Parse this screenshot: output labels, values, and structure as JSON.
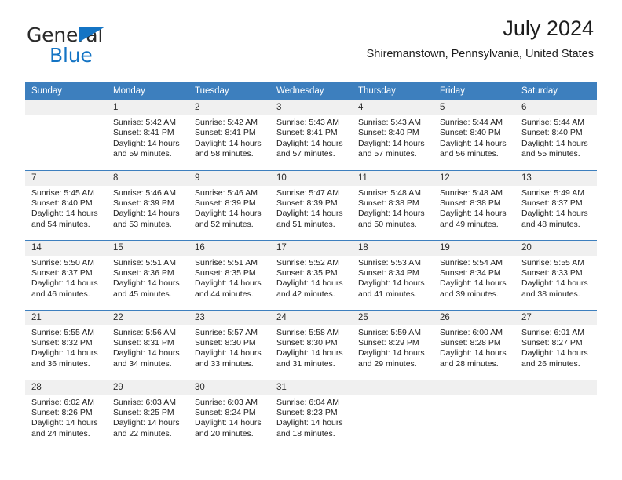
{
  "brand": {
    "line1": "General",
    "line2": "Blue",
    "triangle_color": "#1474c4",
    "text_color": "#2b2b2b"
  },
  "header": {
    "title": "July 2024",
    "subtitle": "Shiremanstown, Pennsylvania, United States"
  },
  "theme": {
    "header_blue": "#3d7fbe",
    "daynum_band": "#f0f0f0",
    "text": "#1f1f1f"
  },
  "calendar": {
    "weekday_headers": [
      "Sunday",
      "Monday",
      "Tuesday",
      "Wednesday",
      "Thursday",
      "Friday",
      "Saturday"
    ],
    "weeks": [
      [
        {
          "day": "",
          "sunrise": "",
          "sunset": "",
          "daylight_line1": "",
          "daylight_line2": "",
          "empty": true
        },
        {
          "day": "1",
          "sunrise": "Sunrise: 5:42 AM",
          "sunset": "Sunset: 8:41 PM",
          "daylight_line1": "Daylight: 14 hours",
          "daylight_line2": "and 59 minutes.",
          "empty": false
        },
        {
          "day": "2",
          "sunrise": "Sunrise: 5:42 AM",
          "sunset": "Sunset: 8:41 PM",
          "daylight_line1": "Daylight: 14 hours",
          "daylight_line2": "and 58 minutes.",
          "empty": false
        },
        {
          "day": "3",
          "sunrise": "Sunrise: 5:43 AM",
          "sunset": "Sunset: 8:41 PM",
          "daylight_line1": "Daylight: 14 hours",
          "daylight_line2": "and 57 minutes.",
          "empty": false
        },
        {
          "day": "4",
          "sunrise": "Sunrise: 5:43 AM",
          "sunset": "Sunset: 8:40 PM",
          "daylight_line1": "Daylight: 14 hours",
          "daylight_line2": "and 57 minutes.",
          "empty": false
        },
        {
          "day": "5",
          "sunrise": "Sunrise: 5:44 AM",
          "sunset": "Sunset: 8:40 PM",
          "daylight_line1": "Daylight: 14 hours",
          "daylight_line2": "and 56 minutes.",
          "empty": false
        },
        {
          "day": "6",
          "sunrise": "Sunrise: 5:44 AM",
          "sunset": "Sunset: 8:40 PM",
          "daylight_line1": "Daylight: 14 hours",
          "daylight_line2": "and 55 minutes.",
          "empty": false
        }
      ],
      [
        {
          "day": "7",
          "sunrise": "Sunrise: 5:45 AM",
          "sunset": "Sunset: 8:40 PM",
          "daylight_line1": "Daylight: 14 hours",
          "daylight_line2": "and 54 minutes.",
          "empty": false
        },
        {
          "day": "8",
          "sunrise": "Sunrise: 5:46 AM",
          "sunset": "Sunset: 8:39 PM",
          "daylight_line1": "Daylight: 14 hours",
          "daylight_line2": "and 53 minutes.",
          "empty": false
        },
        {
          "day": "9",
          "sunrise": "Sunrise: 5:46 AM",
          "sunset": "Sunset: 8:39 PM",
          "daylight_line1": "Daylight: 14 hours",
          "daylight_line2": "and 52 minutes.",
          "empty": false
        },
        {
          "day": "10",
          "sunrise": "Sunrise: 5:47 AM",
          "sunset": "Sunset: 8:39 PM",
          "daylight_line1": "Daylight: 14 hours",
          "daylight_line2": "and 51 minutes.",
          "empty": false
        },
        {
          "day": "11",
          "sunrise": "Sunrise: 5:48 AM",
          "sunset": "Sunset: 8:38 PM",
          "daylight_line1": "Daylight: 14 hours",
          "daylight_line2": "and 50 minutes.",
          "empty": false
        },
        {
          "day": "12",
          "sunrise": "Sunrise: 5:48 AM",
          "sunset": "Sunset: 8:38 PM",
          "daylight_line1": "Daylight: 14 hours",
          "daylight_line2": "and 49 minutes.",
          "empty": false
        },
        {
          "day": "13",
          "sunrise": "Sunrise: 5:49 AM",
          "sunset": "Sunset: 8:37 PM",
          "daylight_line1": "Daylight: 14 hours",
          "daylight_line2": "and 48 minutes.",
          "empty": false
        }
      ],
      [
        {
          "day": "14",
          "sunrise": "Sunrise: 5:50 AM",
          "sunset": "Sunset: 8:37 PM",
          "daylight_line1": "Daylight: 14 hours",
          "daylight_line2": "and 46 minutes.",
          "empty": false
        },
        {
          "day": "15",
          "sunrise": "Sunrise: 5:51 AM",
          "sunset": "Sunset: 8:36 PM",
          "daylight_line1": "Daylight: 14 hours",
          "daylight_line2": "and 45 minutes.",
          "empty": false
        },
        {
          "day": "16",
          "sunrise": "Sunrise: 5:51 AM",
          "sunset": "Sunset: 8:35 PM",
          "daylight_line1": "Daylight: 14 hours",
          "daylight_line2": "and 44 minutes.",
          "empty": false
        },
        {
          "day": "17",
          "sunrise": "Sunrise: 5:52 AM",
          "sunset": "Sunset: 8:35 PM",
          "daylight_line1": "Daylight: 14 hours",
          "daylight_line2": "and 42 minutes.",
          "empty": false
        },
        {
          "day": "18",
          "sunrise": "Sunrise: 5:53 AM",
          "sunset": "Sunset: 8:34 PM",
          "daylight_line1": "Daylight: 14 hours",
          "daylight_line2": "and 41 minutes.",
          "empty": false
        },
        {
          "day": "19",
          "sunrise": "Sunrise: 5:54 AM",
          "sunset": "Sunset: 8:34 PM",
          "daylight_line1": "Daylight: 14 hours",
          "daylight_line2": "and 39 minutes.",
          "empty": false
        },
        {
          "day": "20",
          "sunrise": "Sunrise: 5:55 AM",
          "sunset": "Sunset: 8:33 PM",
          "daylight_line1": "Daylight: 14 hours",
          "daylight_line2": "and 38 minutes.",
          "empty": false
        }
      ],
      [
        {
          "day": "21",
          "sunrise": "Sunrise: 5:55 AM",
          "sunset": "Sunset: 8:32 PM",
          "daylight_line1": "Daylight: 14 hours",
          "daylight_line2": "and 36 minutes.",
          "empty": false
        },
        {
          "day": "22",
          "sunrise": "Sunrise: 5:56 AM",
          "sunset": "Sunset: 8:31 PM",
          "daylight_line1": "Daylight: 14 hours",
          "daylight_line2": "and 34 minutes.",
          "empty": false
        },
        {
          "day": "23",
          "sunrise": "Sunrise: 5:57 AM",
          "sunset": "Sunset: 8:30 PM",
          "daylight_line1": "Daylight: 14 hours",
          "daylight_line2": "and 33 minutes.",
          "empty": false
        },
        {
          "day": "24",
          "sunrise": "Sunrise: 5:58 AM",
          "sunset": "Sunset: 8:30 PM",
          "daylight_line1": "Daylight: 14 hours",
          "daylight_line2": "and 31 minutes.",
          "empty": false
        },
        {
          "day": "25",
          "sunrise": "Sunrise: 5:59 AM",
          "sunset": "Sunset: 8:29 PM",
          "daylight_line1": "Daylight: 14 hours",
          "daylight_line2": "and 29 minutes.",
          "empty": false
        },
        {
          "day": "26",
          "sunrise": "Sunrise: 6:00 AM",
          "sunset": "Sunset: 8:28 PM",
          "daylight_line1": "Daylight: 14 hours",
          "daylight_line2": "and 28 minutes.",
          "empty": false
        },
        {
          "day": "27",
          "sunrise": "Sunrise: 6:01 AM",
          "sunset": "Sunset: 8:27 PM",
          "daylight_line1": "Daylight: 14 hours",
          "daylight_line2": "and 26 minutes.",
          "empty": false
        }
      ],
      [
        {
          "day": "28",
          "sunrise": "Sunrise: 6:02 AM",
          "sunset": "Sunset: 8:26 PM",
          "daylight_line1": "Daylight: 14 hours",
          "daylight_line2": "and 24 minutes.",
          "empty": false
        },
        {
          "day": "29",
          "sunrise": "Sunrise: 6:03 AM",
          "sunset": "Sunset: 8:25 PM",
          "daylight_line1": "Daylight: 14 hours",
          "daylight_line2": "and 22 minutes.",
          "empty": false
        },
        {
          "day": "30",
          "sunrise": "Sunrise: 6:03 AM",
          "sunset": "Sunset: 8:24 PM",
          "daylight_line1": "Daylight: 14 hours",
          "daylight_line2": "and 20 minutes.",
          "empty": false
        },
        {
          "day": "31",
          "sunrise": "Sunrise: 6:04 AM",
          "sunset": "Sunset: 8:23 PM",
          "daylight_line1": "Daylight: 14 hours",
          "daylight_line2": "and 18 minutes.",
          "empty": false
        },
        {
          "day": "",
          "sunrise": "",
          "sunset": "",
          "daylight_line1": "",
          "daylight_line2": "",
          "empty": true
        },
        {
          "day": "",
          "sunrise": "",
          "sunset": "",
          "daylight_line1": "",
          "daylight_line2": "",
          "empty": true
        },
        {
          "day": "",
          "sunrise": "",
          "sunset": "",
          "daylight_line1": "",
          "daylight_line2": "",
          "empty": true
        }
      ]
    ]
  }
}
